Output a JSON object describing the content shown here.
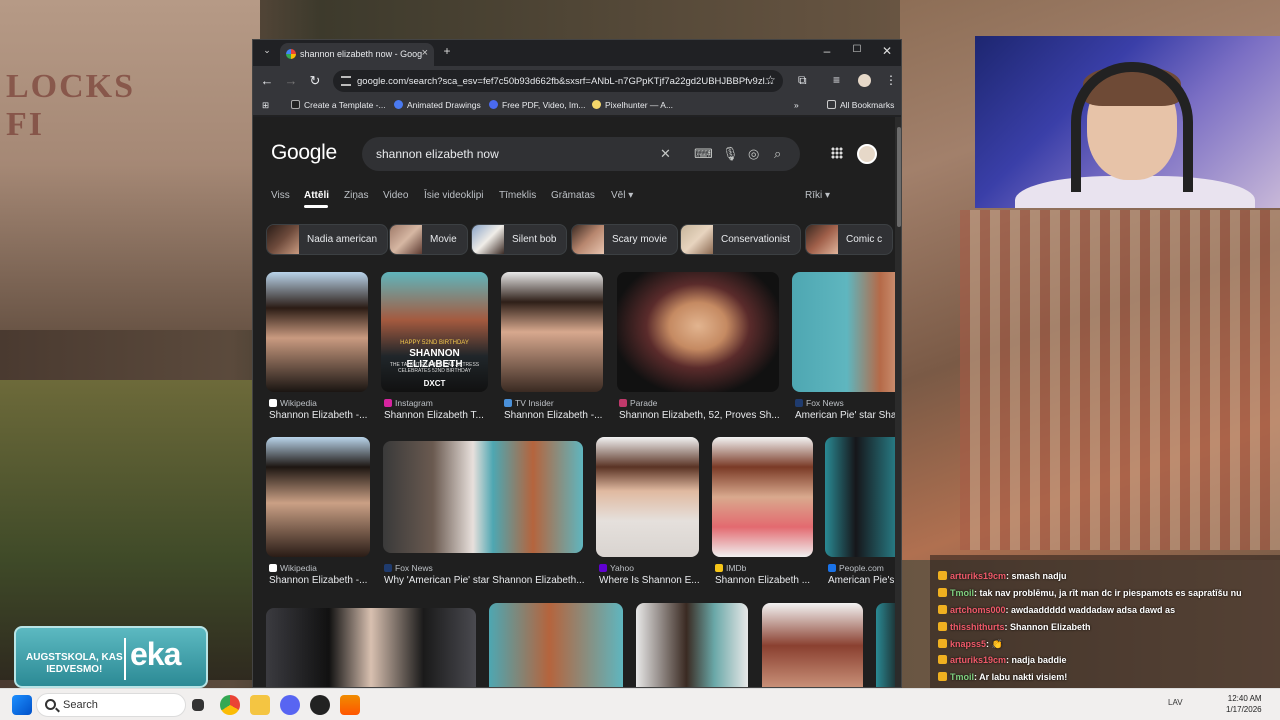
{
  "browser": {
    "tab_title": "shannon elizabeth now - Goog",
    "new_tab": "+",
    "url": "google.com/search?sca_esv=fef7c50b93d662fb&sxsrf=ANbL-n7GPpKTjf7a22gd2UBHJBBPfv9zl...",
    "bookmarks": [
      "Create a Template -...",
      "Animated Drawings",
      "Free PDF, Video, Im...",
      "Pixelhunter — A...",
      "All Bookmarks"
    ]
  },
  "google": {
    "logo": "Google",
    "query": "shannon elizabeth now",
    "tabs": [
      "Viss",
      "Attēli",
      "Ziņas",
      "Video",
      "Īsie videoklipi",
      "Tīmeklis",
      "Grāmatas",
      "Vēl"
    ],
    "tools": "Rīki",
    "chips": [
      "Nadia american",
      "Movie",
      "Silent bob",
      "Scary movie",
      "Conservationist",
      "Comic c"
    ],
    "row1": [
      {
        "source": "Wikipedia",
        "caption": "Shannon Elizabeth -..."
      },
      {
        "source": "Instagram",
        "caption": "Shannon Elizabeth T..."
      },
      {
        "source": "TV Insider",
        "caption": "Shannon Elizabeth -..."
      },
      {
        "source": "Parade",
        "caption": "Shannon Elizabeth, 52, Proves Sh..."
      },
      {
        "source": "Fox News",
        "caption": "American Pie' star Shan"
      }
    ],
    "row2": [
      {
        "source": "Wikipedia",
        "caption": "Shannon Elizabeth -..."
      },
      {
        "source": "Fox News",
        "caption": "Why 'American Pie' star Shannon Elizabeth..."
      },
      {
        "source": "Yahoo",
        "caption": "Where Is Shannon E..."
      },
      {
        "source": "IMDb",
        "caption": "Shannon Elizabeth ..."
      },
      {
        "source": "People.com",
        "caption": "American Pie's"
      }
    ],
    "overlay_text": {
      "happy": "HAPPY 52ND BIRTHDAY",
      "name": "SHANNON ELIZABETH",
      "sub": "THE TALENTED AMERICAN ACTRESS CELEBRATES 52ND BIRTHDAY",
      "brand": "DXCT"
    }
  },
  "chat": [
    {
      "user": "arturiks19cm",
      "msg": ": smash nadju"
    },
    {
      "user": "Tmoil",
      "msg": ": tak nav problēmu, ja rīt man dc ir piespamots es sapratīšu nu"
    },
    {
      "user": "artchoms000",
      "msg": ": awdaaddddd waddadaw adsa dawd as"
    },
    {
      "user": "thisshithurts",
      "msg": ": Shannon Elizabeth"
    },
    {
      "user": "knapss5",
      "msg": ": 👏"
    },
    {
      "user": "arturiks19cm",
      "msg": ": nadja baddie"
    },
    {
      "user": "Tmoil",
      "msg": ": Ar labu nakti visiem!"
    }
  ],
  "banner": {
    "line1": "AUGSTSKOLA, KAS",
    "line2": "IEDVESMO!",
    "brand": "eka"
  },
  "background_sign": "LOCKS FI",
  "taskbar": {
    "search": "Search",
    "lang": "LAV",
    "time": "12:40 AM",
    "date": "1/17/2026"
  }
}
